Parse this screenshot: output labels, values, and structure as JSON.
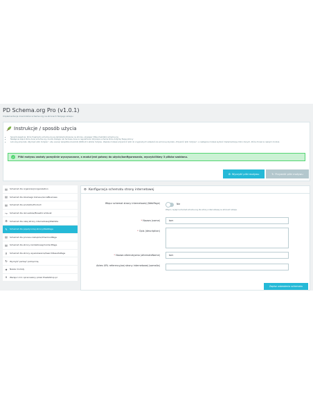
{
  "header": {
    "title": "PD Schema.org Pro (v1.0.1)",
    "subtitle": "Implementacja znaczników schema.org na stronach Twojego sklepu"
  },
  "instructions": {
    "heading": "Instrukcje / sposób użycia",
    "items": [
      "Sposób zagadnie: które fragmenty schema.org są zaimplementowane na stronie, używając https://validator.schema.org",
      "Następnie włącz które dane schema.org, klucze dostępu lub fachowe dane w regulaminie dotyczące schema które dotyczą Twojej strony",
      "Lub użyj przycisku „Wyczyść pliki motywu”, aby usunąć wszystkie znaczniki JSON-LD z plików motywu. Zawsze możesz przywrócić pliki do oryginalnych ustawień za pomocą przycisku „Przywróć pliki motywu”, a następnie możesz wybrać implementację mikro danych, które chcesz w naszym module"
    ],
    "alert": "Pliki motywu zostały pomyślnie wyczyszczone, a moduł jest gotowy do użycia/konfigurowania, wyczyściliśmy 3 plików szablonu."
  },
  "buttons": {
    "clean": "Wyczyść pliki motywu",
    "restore": "Przywróć pliki motywu",
    "save": "Zapisz ustawienia schematu"
  },
  "sidebar": {
    "items": [
      {
        "label": "Schemat dla organizacji/organization",
        "icon": "▤",
        "active": false
      },
      {
        "label": "Schemat dla lokalnego biznesu/LocalBusiness",
        "icon": "▤",
        "active": false
      },
      {
        "label": "Schemat dla produktu/Product",
        "icon": "▤",
        "active": false
      },
      {
        "label": "Schemat dla okruszków/BreadCrumbList",
        "icon": "↪",
        "active": false
      },
      {
        "label": "Schemat dla całej strony internetowej/WebSite",
        "icon": "⚙",
        "active": false
      },
      {
        "label": "Schemat dla pojedynczej strony/WebPage",
        "icon": "✎",
        "active": true
      },
      {
        "label": "Schemat dla procesu zakupów/CheckoutPage",
        "icon": "▤",
        "active": false
      },
      {
        "label": "Schemat dla strony kontaktowej/ContactPage",
        "icon": "▤",
        "active": false
      },
      {
        "label": "Schemat dla strony wyszukiwania/SearchResultsPage",
        "icon": "⚲",
        "active": false
      },
      {
        "label": "Wyczyść pamięć podręczną",
        "icon": "↻",
        "active": false
      },
      {
        "label": "Nasze moduły",
        "icon": "★",
        "active": false
      },
      {
        "label": "Wersja 1.0.1 opracowany przez PrestaShop.pl",
        "icon": "ℹ",
        "active": false
      }
    ]
  },
  "form": {
    "title": "Konfiguracja schematu strony internetowej",
    "enable_label": "Włącz schemat strony internetowej (WebPage)",
    "enable_value": "Nie",
    "enable_help": "Włącz / wyłącz schemat schema.org dla strony internetowej na stronach sklepu",
    "name_label": "Nazwa (name)",
    "name_value": "tom",
    "desc_label": "Opis (description)",
    "desc_value": "",
    "altname_label": "Nazwa alternatywna (alternateName)",
    "altname_value": "tom",
    "url_label": "Adres URL referencyjnej strony internetowej (sameAs)",
    "url_value": ""
  },
  "colors": {
    "accent": "#25b9d7",
    "success": "#53d572",
    "background": "#eff1f2"
  }
}
